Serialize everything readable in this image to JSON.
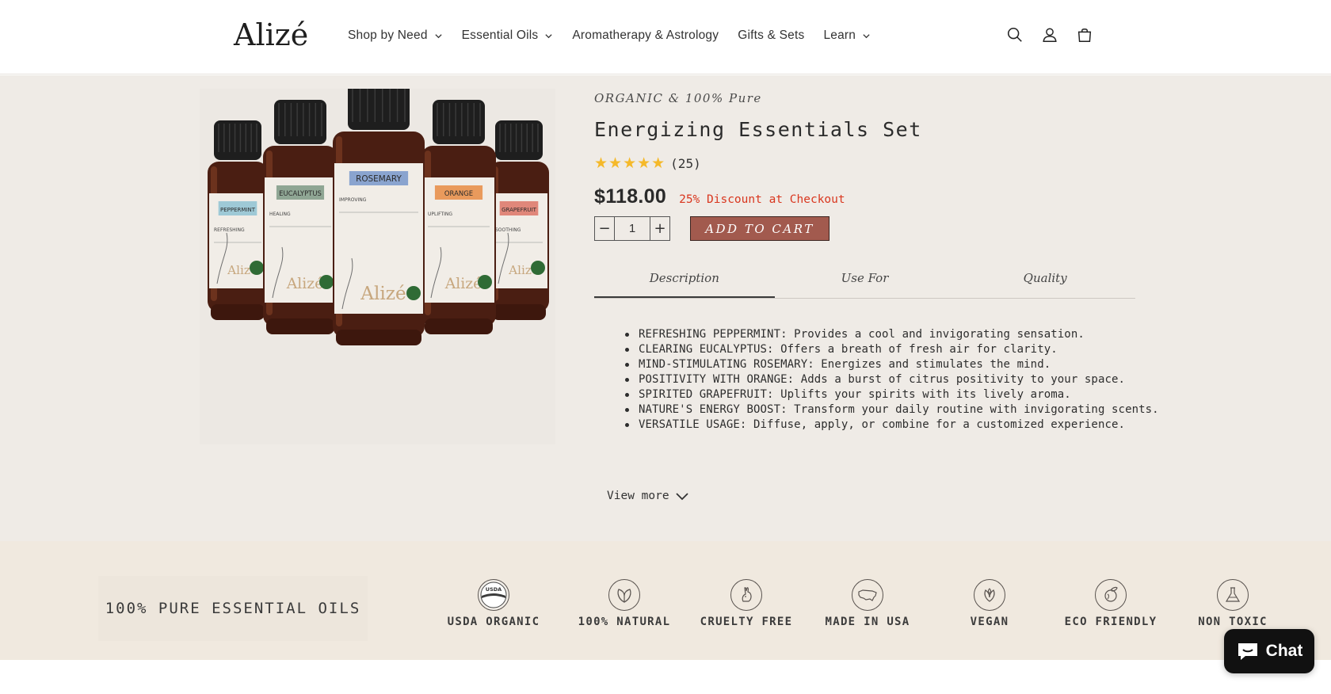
{
  "brand": {
    "logo_text": "Alizé"
  },
  "nav": {
    "items": [
      {
        "label": "Shop by Need",
        "has_dropdown": true
      },
      {
        "label": "Essential Oils",
        "has_dropdown": true
      },
      {
        "label": "Aromatherapy & Astrology",
        "has_dropdown": false
      },
      {
        "label": "Gifts & Sets",
        "has_dropdown": false
      },
      {
        "label": "Learn",
        "has_dropdown": true
      }
    ],
    "icons": [
      "search-icon",
      "account-icon",
      "cart-icon"
    ]
  },
  "product": {
    "subtitle": "ORGANIC & 100% Pure",
    "title": "Energizing Essentials Set",
    "stars": "★★★★★",
    "rating_value": 5,
    "review_count": "(25)",
    "price": "$118.00",
    "discount_text": "25% Discount at Checkout",
    "quantity": "1",
    "minus_label": "−",
    "plus_label": "+",
    "add_to_cart": "ADD TO CART",
    "bottles": [
      {
        "label": "PEPPERMINT",
        "sub": "REFRESHING",
        "color": "#9ec9d6"
      },
      {
        "label": "EUCALYPTUS",
        "sub": "HEALING",
        "color": "#8fa694"
      },
      {
        "label": "ROSEMARY",
        "sub": "IMPROVING",
        "color": "#8aa4cf"
      },
      {
        "label": "ORANGE",
        "sub": "UPLIFTING",
        "color": "#e99a5c"
      },
      {
        "label": "GRAPEFRUIT",
        "sub": "SOOTHING",
        "color": "#e0877a"
      }
    ],
    "bottle_brand": "Alizé",
    "tabs": [
      "Description",
      "Use For",
      "Quality"
    ],
    "active_tab": "Description",
    "description": [
      "REFRESHING PEPPERMINT: Provides a cool and invigorating sensation.",
      "CLEARING EUCALYPTUS: Offers a breath of fresh air for clarity.",
      "MIND-STIMULATING ROSEMARY: Energizes and stimulates the mind.",
      "POSITIVITY WITH ORANGE: Adds a burst of citrus positivity to your space.",
      "SPIRITED GRAPEFRUIT: Uplifts your spirits with its lively aroma.",
      "NATURE'S ENERGY BOOST: Transform your daily routine with invigorating scents.",
      "VERSATILE USAGE: Diffuse, apply, or combine for a customized experience."
    ],
    "view_more": "View more"
  },
  "badges": {
    "headline": "100% PURE ESSENTIAL OILS",
    "items": [
      {
        "label": "USDA ORGANIC",
        "icon": "usda-organic-icon"
      },
      {
        "label": "100% NATURAL",
        "icon": "leaf-icon"
      },
      {
        "label": "CRUELTY FREE",
        "icon": "rabbit-icon"
      },
      {
        "label": "MADE IN USA",
        "icon": "usa-map-icon"
      },
      {
        "label": "VEGAN",
        "icon": "vegan-leaf-icon"
      },
      {
        "label": "ECO FRIENDLY",
        "icon": "eco-globe-icon"
      },
      {
        "label": "NON TOXIC",
        "icon": "flask-icon"
      }
    ],
    "usda_text": "USDA"
  },
  "chat": {
    "label": "Chat"
  },
  "colors": {
    "accent_button": "#a25a4e",
    "discount": "#d9361e",
    "stars": "#f5b92a",
    "product_bg": "#efebe6",
    "badge_bg": "#f0e9df"
  }
}
